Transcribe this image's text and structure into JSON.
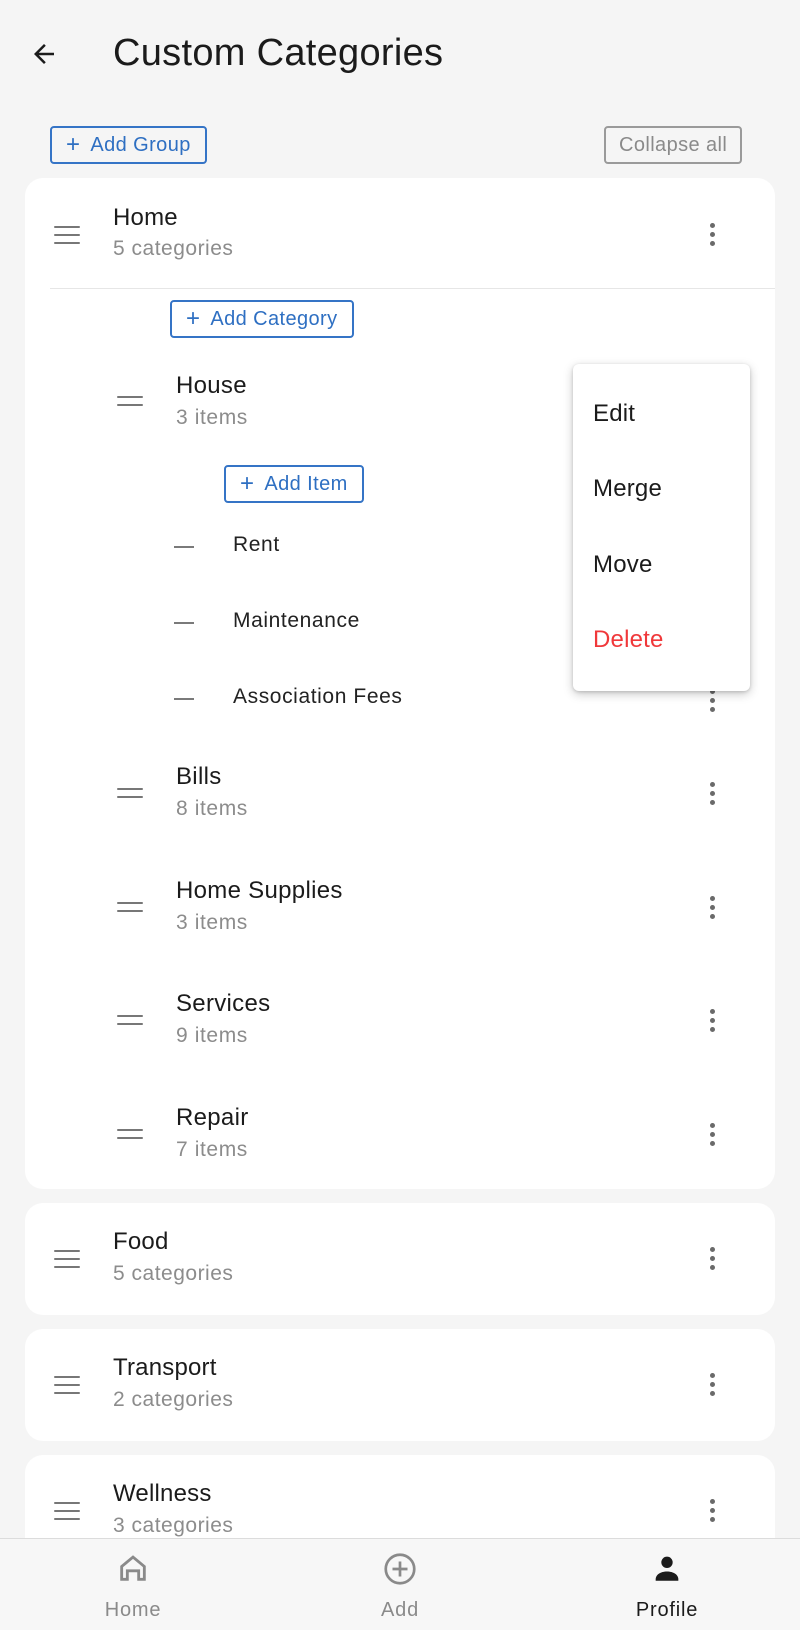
{
  "header": {
    "title": "Custom Categories",
    "back_icon": "arrow-left-icon"
  },
  "toolbar": {
    "add_group_label": "Add Group",
    "collapse_all_label": "Collapse all"
  },
  "groups": [
    {
      "name": "Home",
      "subtitle": "5 categories",
      "expanded": true,
      "add_category_label": "Add Category",
      "categories": [
        {
          "name": "House",
          "subtitle": "3 items",
          "expanded": true,
          "add_item_label": "Add Item",
          "items": [
            "Rent",
            "Maintenance",
            "Association Fees"
          ]
        },
        {
          "name": "Bills",
          "subtitle": "8 items"
        },
        {
          "name": "Home Supplies",
          "subtitle": "3 items"
        },
        {
          "name": "Services",
          "subtitle": "9 items"
        },
        {
          "name": "Repair",
          "subtitle": "7 items"
        }
      ]
    },
    {
      "name": "Food",
      "subtitle": "5 categories"
    },
    {
      "name": "Transport",
      "subtitle": "2 categories"
    },
    {
      "name": "Wellness",
      "subtitle": "3 categories"
    }
  ],
  "context_menu": {
    "items": [
      {
        "label": "Edit"
      },
      {
        "label": "Merge"
      },
      {
        "label": "Move"
      },
      {
        "label": "Delete",
        "danger_color": "#f0383a"
      }
    ]
  },
  "bottom_nav": {
    "items": [
      {
        "label": "Home",
        "icon": "home-icon",
        "active": false
      },
      {
        "label": "Add",
        "icon": "add-circle-icon",
        "active": false
      },
      {
        "label": "Profile",
        "icon": "person-icon",
        "active": true
      }
    ]
  },
  "colors": {
    "accent": "#2e6fc2",
    "danger": "#f0383a",
    "background": "#f5f5f5"
  }
}
